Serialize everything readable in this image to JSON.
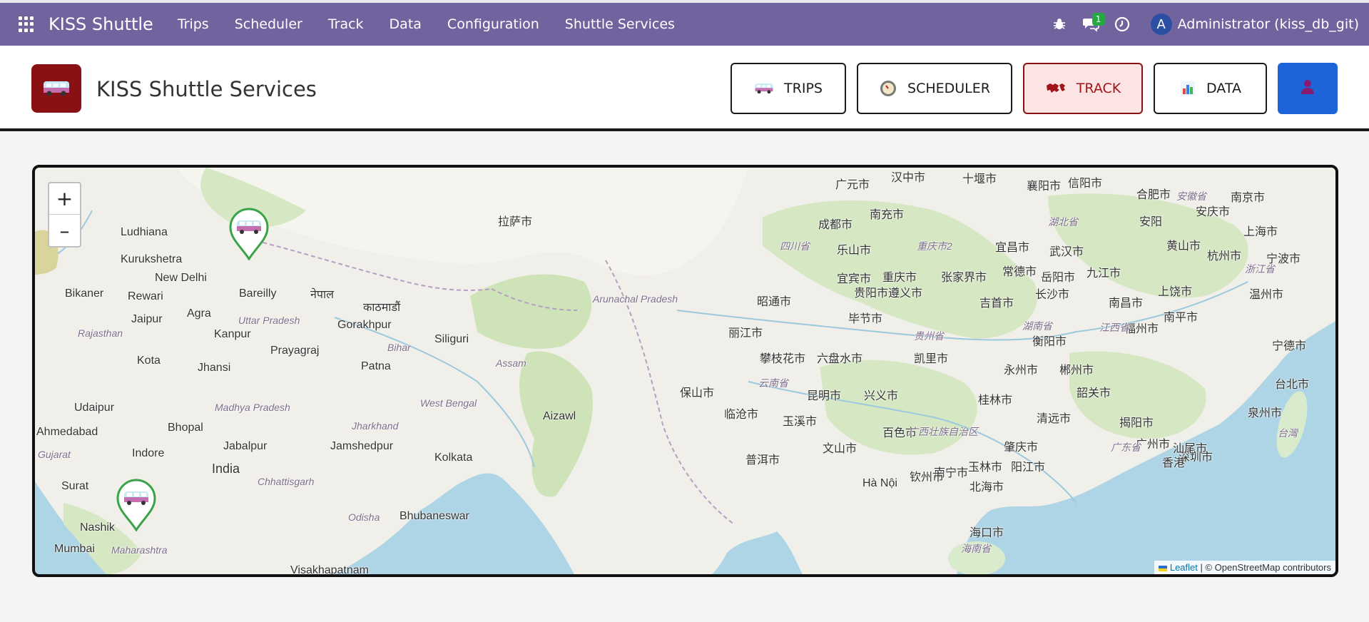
{
  "navbar": {
    "brand": "KISS Shuttle",
    "menu": [
      "Trips",
      "Scheduler",
      "Track",
      "Data",
      "Configuration",
      "Shuttle Services"
    ],
    "messages_badge": "1",
    "avatar_letter": "A",
    "user": "Administrator (kiss_db_git)",
    "bg_color": "#71639e"
  },
  "header": {
    "title": "KISS Shuttle Services",
    "buttons": {
      "trips": "TRIPS",
      "scheduler": "SCHEDULER",
      "track": "TRACK",
      "data": "DATA"
    },
    "active_button": "track",
    "accent_color": "#8a1113"
  },
  "map": {
    "zoom_in": "+",
    "zoom_out": "–",
    "attribution_leaflet": "Leaflet",
    "attribution_rest": " | © OpenStreetMap contributors",
    "markers": [
      "Dehradun",
      "Chhatrapati Sambhajinagar"
    ],
    "labels": [
      "Ludhiana",
      "Kurukshetra",
      "New Delhi",
      "Bikaner",
      "Rewari",
      "Agra",
      "Jaipur",
      "Bareilly",
      "Kanpur",
      "Uttar Pradesh",
      "Rajasthan",
      "Kota",
      "Gorakhpur",
      "Prayagraj",
      "Siliguri",
      "Patna",
      "Bihar",
      "Jhansi",
      "Udaipur",
      "Bhopal",
      "Madhya Pradesh",
      "Ahmedabad",
      "Gujarat",
      "Indore",
      "Jabalpur",
      "Jamshedpur",
      "Jharkhand",
      "West Bengal",
      "Kolkata",
      "India",
      "Chhattisgarh",
      "Surat",
      "Nashik",
      "Mumbai",
      "Maharashtra",
      "Odisha",
      "Bhubaneswar",
      "Visakhapatnam",
      "Aizawl",
      "Arunachal Pradesh",
      "Assam",
      "Hà Nội",
      "नेपाल",
      "काठमाडौं",
      "拉萨市",
      "成都市",
      "重庆市",
      "武汉市",
      "长沙市",
      "昆明市",
      "贵阳市",
      "南宁市",
      "广州市",
      "深圳市",
      "香港",
      "上海市",
      "杭州市",
      "南京市",
      "福州市",
      "台北市",
      "海口市",
      "昭通市",
      "遵义市",
      "宜宾市",
      "乐山市",
      "南充市",
      "广元市",
      "汉中市",
      "十堰市",
      "襄阳市",
      "信阳市",
      "合肥市",
      "安庆市",
      "黄山市",
      "九江市",
      "南昌市",
      "衡阳市",
      "郴州市",
      "韶关市",
      "清远市",
      "揭阳市",
      "汕尾市",
      "肇庆市",
      "玉林市",
      "阳江市",
      "北海市",
      "钦州市",
      "百色市",
      "文山市",
      "普洱市",
      "玉溪市",
      "临沧市",
      "保山市",
      "丽江市",
      "攀枝花市",
      "六盘水市",
      "凯里市",
      "吉首市",
      "张家界市",
      "宜昌市",
      "岳阳市",
      "常德市",
      "永州市",
      "桂林市",
      "兴义市",
      "毕节市",
      "泉州市",
      "宁德市",
      "温州市",
      "宁波市",
      "上饶市",
      "南平市",
      "安阳",
      "湖南省",
      "贵州省",
      "云南省",
      "广西壮族自治区",
      "广东省",
      "江西省",
      "四川省",
      "重庆市2",
      "湖北省",
      "安徽省",
      "浙江省",
      "台灣",
      "海南省"
    ]
  }
}
